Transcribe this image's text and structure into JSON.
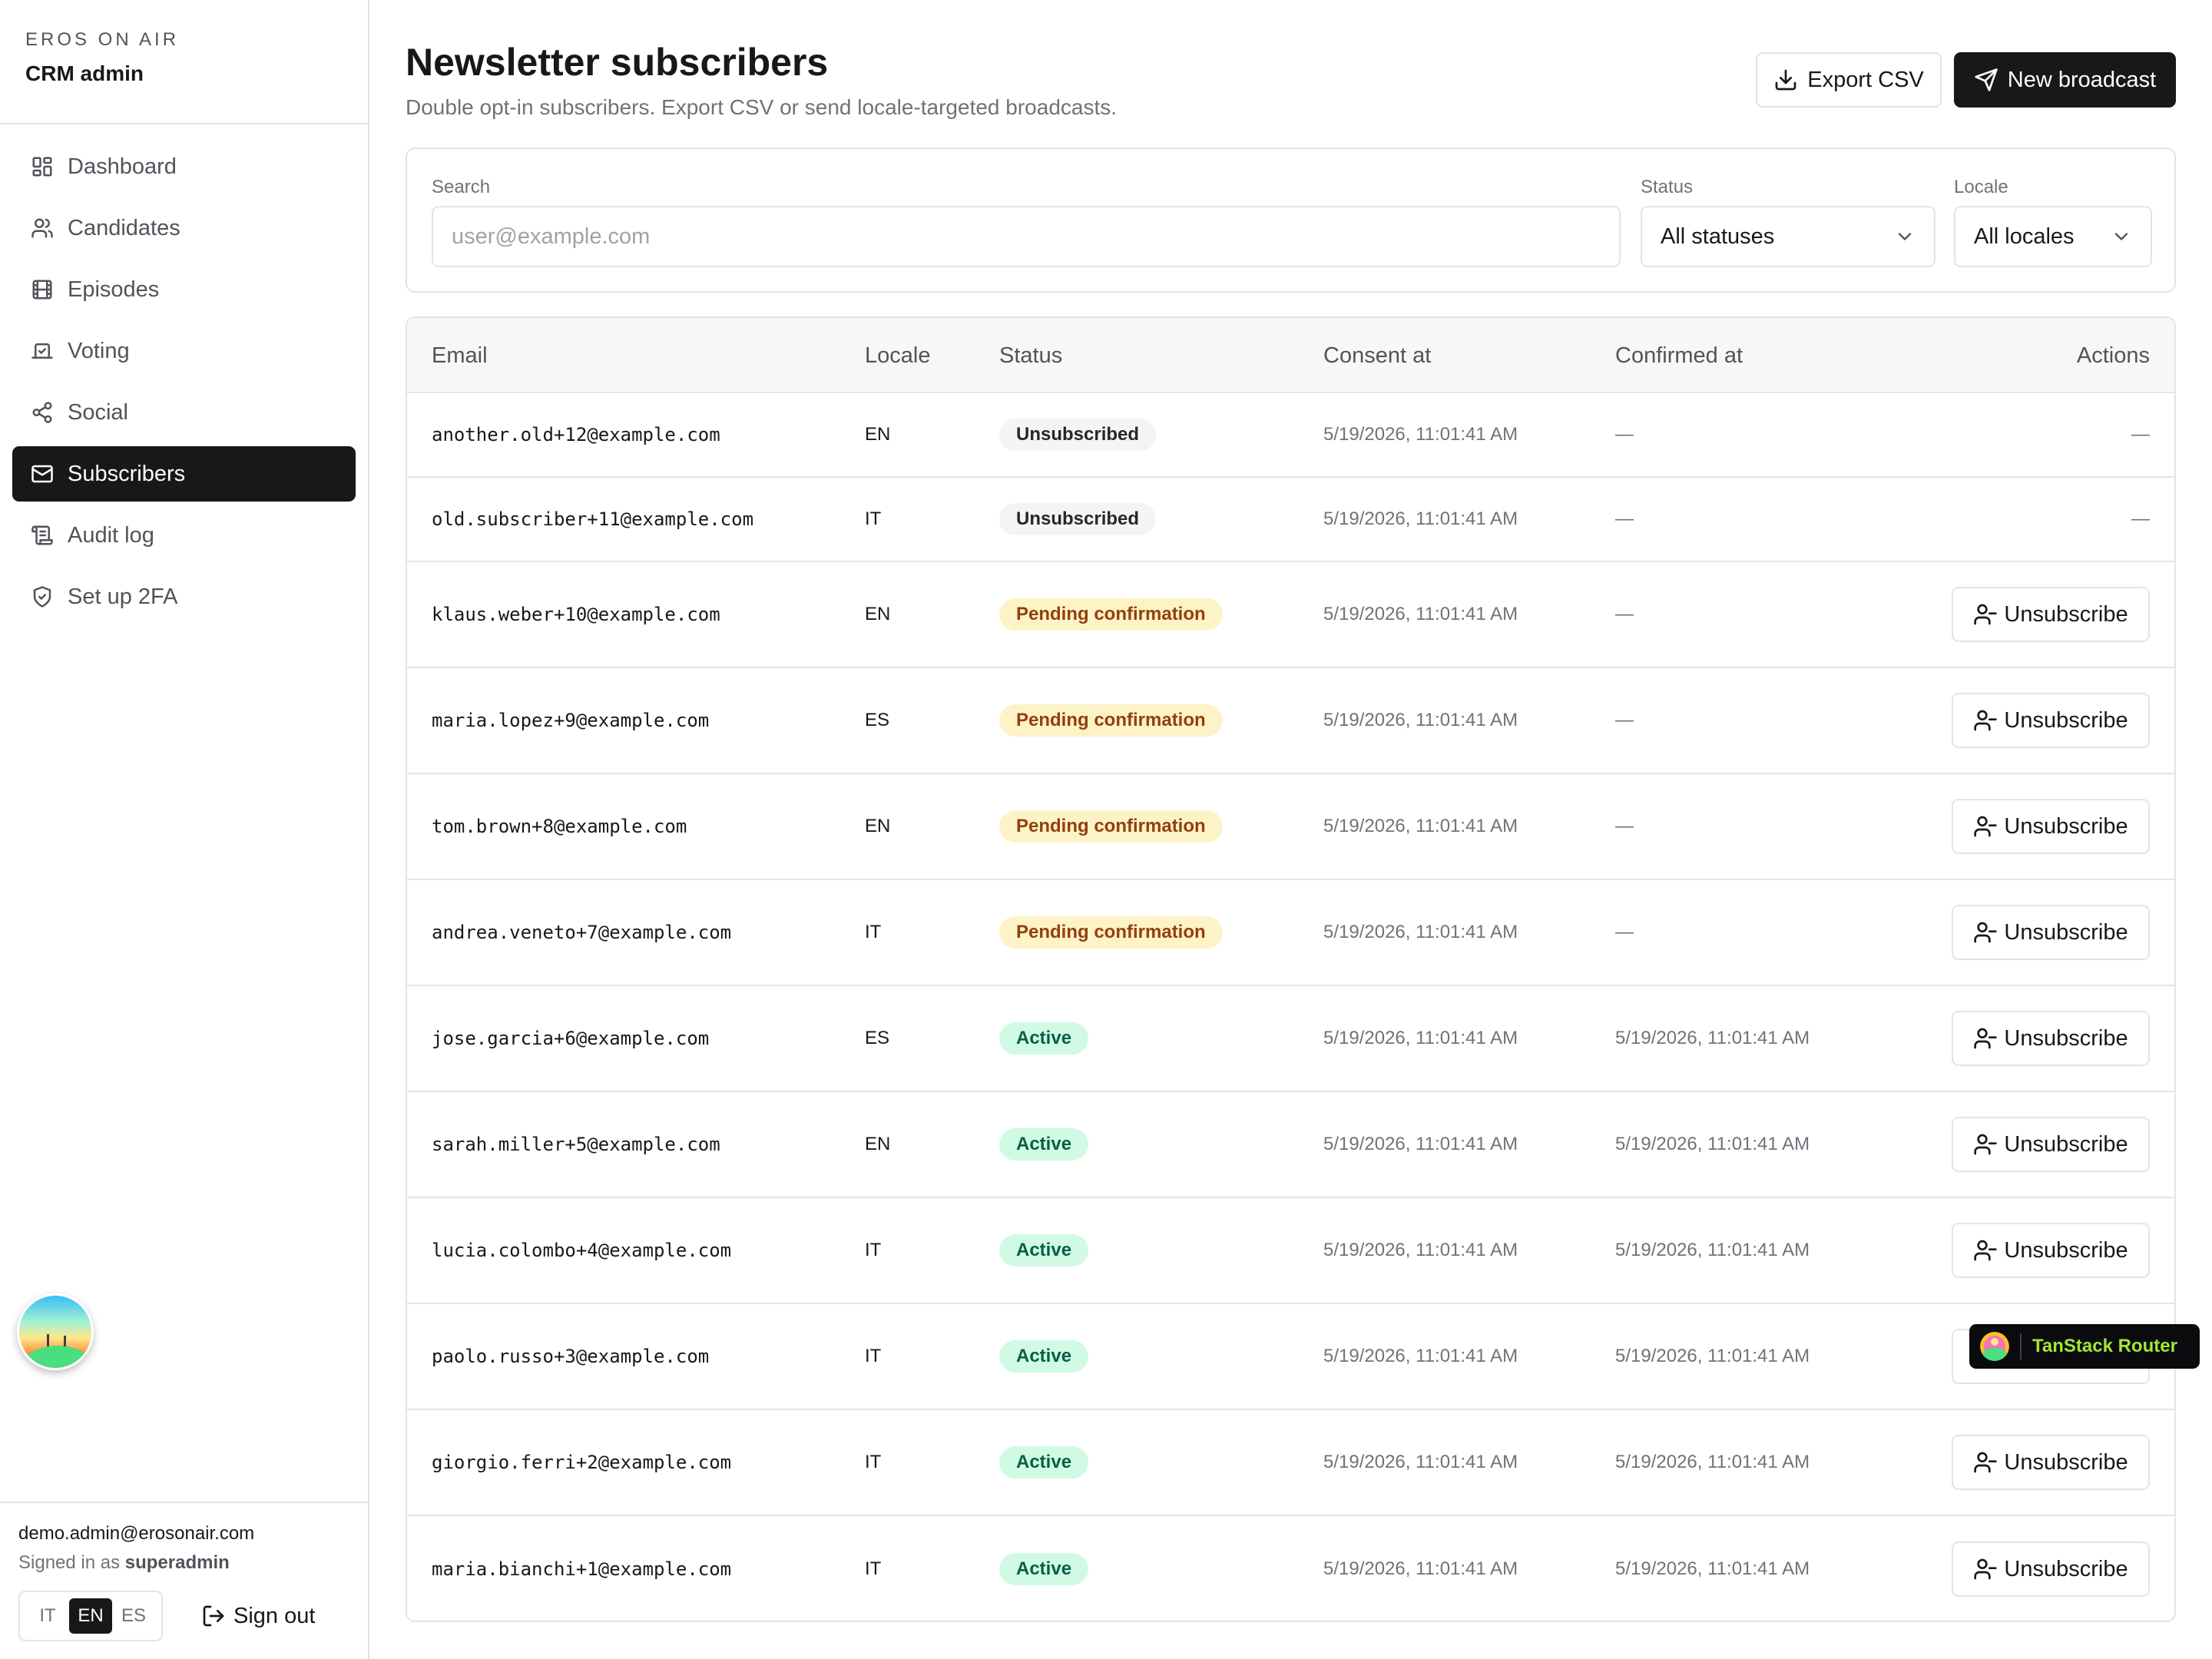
{
  "brand": {
    "eyebrow": "EROS ON AIR",
    "title": "CRM admin"
  },
  "nav": [
    {
      "label": "Dashboard",
      "icon": "dashboard-icon",
      "active": false
    },
    {
      "label": "Candidates",
      "icon": "users-icon",
      "active": false
    },
    {
      "label": "Episodes",
      "icon": "film-icon",
      "active": false
    },
    {
      "label": "Voting",
      "icon": "vote-icon",
      "active": false
    },
    {
      "label": "Social",
      "icon": "share-icon",
      "active": false
    },
    {
      "label": "Subscribers",
      "icon": "mail-icon",
      "active": true
    },
    {
      "label": "Audit log",
      "icon": "scroll-icon",
      "active": false
    },
    {
      "label": "Set up 2FA",
      "icon": "shield-icon",
      "active": false
    }
  ],
  "user": {
    "email": "demo.admin@erosonair.com",
    "signed_in_prefix": "Signed in as",
    "role": "superadmin"
  },
  "languages": [
    {
      "code": "IT",
      "active": false
    },
    {
      "code": "EN",
      "active": true
    },
    {
      "code": "ES",
      "active": false
    }
  ],
  "sign_out": "Sign out",
  "page": {
    "title": "Newsletter subscribers",
    "subtitle": "Double opt-in subscribers. Export CSV or send locale-targeted broadcasts."
  },
  "toolbar": {
    "export_label": "Export CSV",
    "broadcast_label": "New broadcast"
  },
  "filters": {
    "search_label": "Search",
    "search_placeholder": "user@example.com",
    "status_label": "Status",
    "status_value": "All statuses",
    "locale_label": "Locale",
    "locale_value": "All locales"
  },
  "table": {
    "columns": [
      "Email",
      "Locale",
      "Status",
      "Consent at",
      "Confirmed at",
      "Actions"
    ],
    "unsubscribe_label": "Unsubscribe",
    "rows": [
      {
        "email": "another.old+12@example.com",
        "locale": "EN",
        "status": "Unsubscribed",
        "kind": "unsub",
        "consent": "5/19/2026, 11:01:41 AM",
        "confirmed": "—",
        "action": "—"
      },
      {
        "email": "old.subscriber+11@example.com",
        "locale": "IT",
        "status": "Unsubscribed",
        "kind": "unsub",
        "consent": "5/19/2026, 11:01:41 AM",
        "confirmed": "—",
        "action": "—"
      },
      {
        "email": "klaus.weber+10@example.com",
        "locale": "EN",
        "status": "Pending confirmation",
        "kind": "pending",
        "consent": "5/19/2026, 11:01:41 AM",
        "confirmed": "—",
        "action": "unsubscribe"
      },
      {
        "email": "maria.lopez+9@example.com",
        "locale": "ES",
        "status": "Pending confirmation",
        "kind": "pending",
        "consent": "5/19/2026, 11:01:41 AM",
        "confirmed": "—",
        "action": "unsubscribe"
      },
      {
        "email": "tom.brown+8@example.com",
        "locale": "EN",
        "status": "Pending confirmation",
        "kind": "pending",
        "consent": "5/19/2026, 11:01:41 AM",
        "confirmed": "—",
        "action": "unsubscribe"
      },
      {
        "email": "andrea.veneto+7@example.com",
        "locale": "IT",
        "status": "Pending confirmation",
        "kind": "pending",
        "consent": "5/19/2026, 11:01:41 AM",
        "confirmed": "—",
        "action": "unsubscribe"
      },
      {
        "email": "jose.garcia+6@example.com",
        "locale": "ES",
        "status": "Active",
        "kind": "active",
        "consent": "5/19/2026, 11:01:41 AM",
        "confirmed": "5/19/2026, 11:01:41 AM",
        "action": "unsubscribe"
      },
      {
        "email": "sarah.miller+5@example.com",
        "locale": "EN",
        "status": "Active",
        "kind": "active",
        "consent": "5/19/2026, 11:01:41 AM",
        "confirmed": "5/19/2026, 11:01:41 AM",
        "action": "unsubscribe"
      },
      {
        "email": "lucia.colombo+4@example.com",
        "locale": "IT",
        "status": "Active",
        "kind": "active",
        "consent": "5/19/2026, 11:01:41 AM",
        "confirmed": "5/19/2026, 11:01:41 AM",
        "action": "unsubscribe"
      },
      {
        "email": "paolo.russo+3@example.com",
        "locale": "IT",
        "status": "Active",
        "kind": "active",
        "consent": "5/19/2026, 11:01:41 AM",
        "confirmed": "5/19/2026, 11:01:41 AM",
        "action": "unsubscribe"
      },
      {
        "email": "giorgio.ferri+2@example.com",
        "locale": "IT",
        "status": "Active",
        "kind": "active",
        "consent": "5/19/2026, 11:01:41 AM",
        "confirmed": "5/19/2026, 11:01:41 AM",
        "action": "unsubscribe"
      },
      {
        "email": "maria.bianchi+1@example.com",
        "locale": "IT",
        "status": "Active",
        "kind": "active",
        "consent": "5/19/2026, 11:01:41 AM",
        "confirmed": "5/19/2026, 11:01:41 AM",
        "action": "unsubscribe"
      }
    ]
  },
  "devtools": {
    "label": "TanStack Router"
  },
  "colors": {
    "primary": "#18181b",
    "border": "#e4e4e7",
    "muted_text": "#71717a",
    "pending_bg": "#fef3c7",
    "pending_text": "#92400e",
    "active_bg": "#d1fae5",
    "active_text": "#065f46",
    "unsub_bg": "#f4f4f5",
    "router_accent": "#a3e635"
  }
}
